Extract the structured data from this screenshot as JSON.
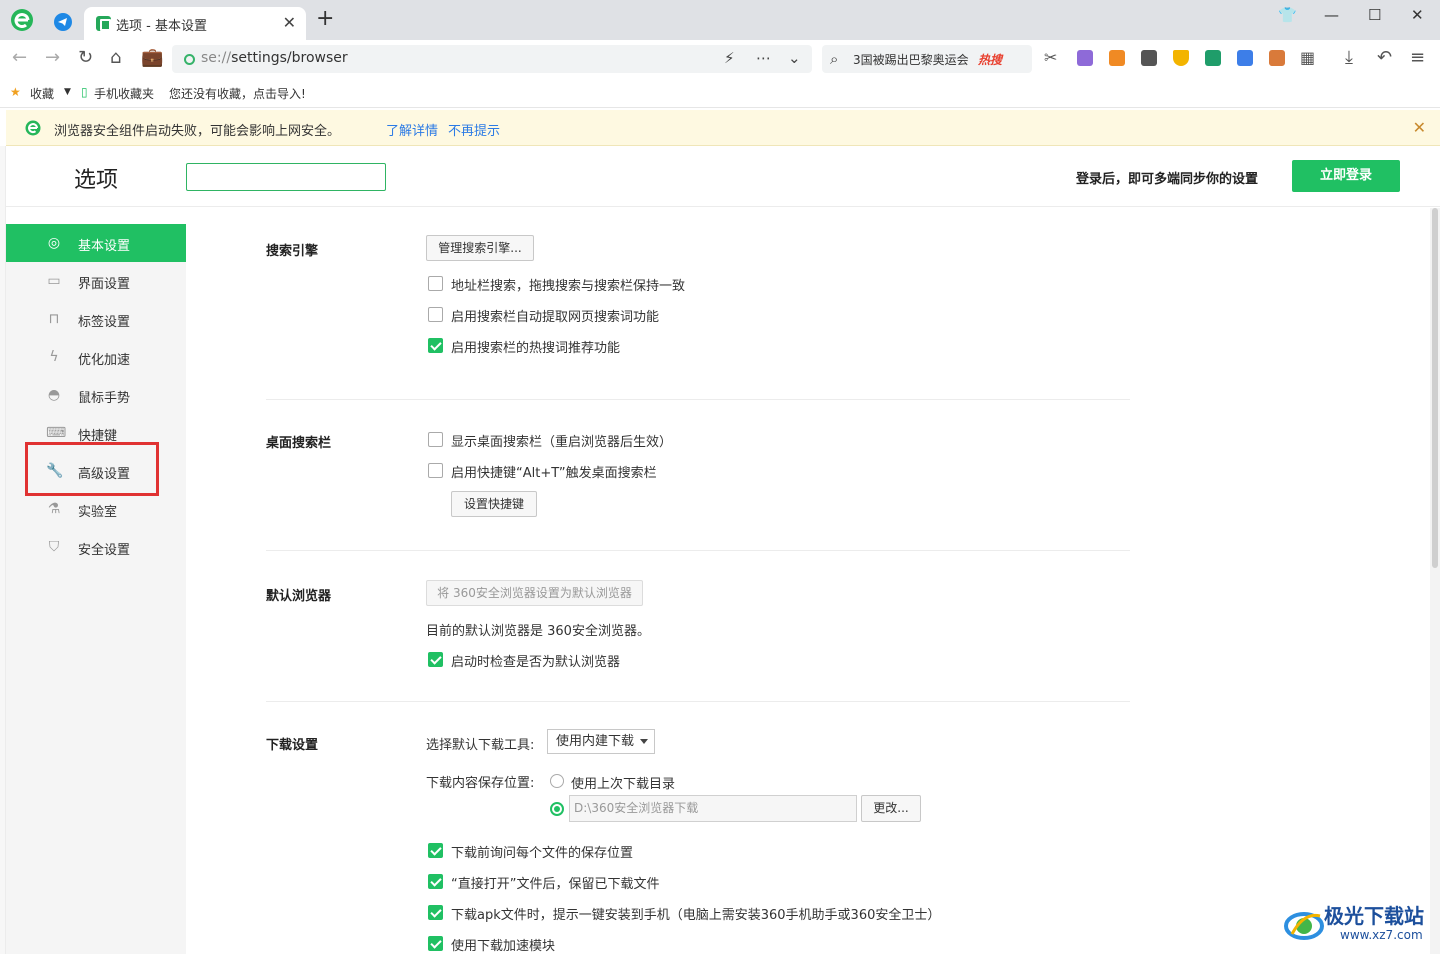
{
  "tab": {
    "title": "选项 - 基本设置"
  },
  "address": {
    "url_scheme": "se://",
    "url_rest": "settings/browser"
  },
  "hot_search": {
    "text": "3国被踢出巴黎奥运会",
    "badge": "热搜"
  },
  "bookmarks": {
    "favorites": "收藏",
    "mobile": "手机收藏夹",
    "empty_hint": "您还没有收藏，点击导入!"
  },
  "notice": {
    "message": "浏览器安全组件启动失败，可能会影响上网安全。",
    "learn_more": "了解详情",
    "dont_show": "不再提示"
  },
  "header": {
    "title": "选项",
    "search_value": "",
    "sync_hint": "登录后，即可多端同步你的设置",
    "login_button": "立即登录"
  },
  "sidebar": {
    "items": [
      {
        "label": "基本设置",
        "icon": "gear-circle-icon",
        "active": true
      },
      {
        "label": "界面设置",
        "icon": "window-icon"
      },
      {
        "label": "标签设置",
        "icon": "tab-icon"
      },
      {
        "label": "优化加速",
        "icon": "lightning-icon"
      },
      {
        "label": "鼠标手势",
        "icon": "mouse-icon"
      },
      {
        "label": "快捷键",
        "icon": "keyboard-icon"
      },
      {
        "label": "高级设置",
        "icon": "wrench-icon",
        "highlighted": true
      },
      {
        "label": "实验室",
        "icon": "flask-icon"
      },
      {
        "label": "安全设置",
        "icon": "shield-icon"
      }
    ]
  },
  "search_engine": {
    "title": "搜索引擎",
    "manage_button": "管理搜索引擎...",
    "options": [
      {
        "label": "地址栏搜索，拖拽搜索与搜索栏保持一致",
        "checked": false
      },
      {
        "label": "启用搜索栏自动提取网页搜索词功能",
        "checked": false
      },
      {
        "label": "启用搜索栏的热搜词推荐功能",
        "checked": true
      }
    ]
  },
  "desktop_search": {
    "title": "桌面搜索栏",
    "options": [
      {
        "label": "显示桌面搜索栏（重启浏览器后生效）",
        "checked": false
      },
      {
        "label": "启用快捷键“Alt+T”触发桌面搜索栏",
        "checked": false
      }
    ],
    "shortcut_button": "设置快捷键"
  },
  "default_browser": {
    "title": "默认浏览器",
    "set_button": "将 360安全浏览器设置为默认浏览器",
    "status": "目前的默认浏览器是 360安全浏览器。",
    "check_option": {
      "label": "启动时检查是否为默认浏览器",
      "checked": true
    }
  },
  "download": {
    "title": "下载设置",
    "tool_label": "选择默认下载工具:",
    "tool_value": "使用内建下载",
    "location_label": "下载内容保存位置:",
    "last_dir_option": "使用上次下载目录",
    "path_value": "D:\\360安全浏览器下载",
    "change_button": "更改...",
    "options": [
      {
        "label": "下载前询问每个文件的保存位置",
        "checked": true
      },
      {
        "label": "“直接打开”文件后，保留已下载文件",
        "checked": true
      },
      {
        "label": "下载apk文件时，提示一键安装到手机（电脑上需安装360手机助手或360安全卫士）",
        "checked": true
      },
      {
        "label": "使用下载加速模块",
        "checked": true
      }
    ]
  },
  "watermark": {
    "name": "极光下载站",
    "url": "www.xz7.com"
  },
  "colors": {
    "accent": "#20c063",
    "highlight": "#e03232",
    "link": "#2c7be5"
  }
}
